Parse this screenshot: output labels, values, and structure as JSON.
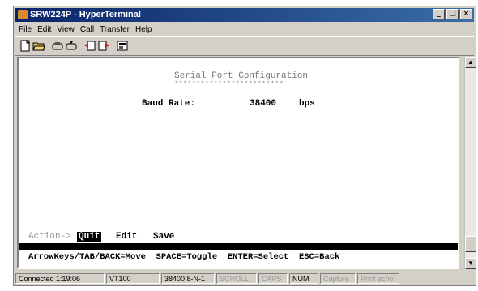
{
  "window": {
    "title": "SRW224P - HyperTerminal",
    "controls": {
      "minimize": "_",
      "maximize": "□",
      "close": "×"
    }
  },
  "menu": [
    "File",
    "Edit",
    "View",
    "Call",
    "Transfer",
    "Help"
  ],
  "toolbar_icons": [
    "new-icon",
    "open-icon",
    "connect-icon",
    "disconnect-icon",
    "send-icon",
    "receive-icon",
    "properties-icon"
  ],
  "terminal": {
    "heading": "Serial Port Configuration",
    "heading_underline": "*************************",
    "field_label": "Baud Rate:",
    "field_value": "38400",
    "field_unit": "bps",
    "action_label": "Action->",
    "actions": [
      "Quit",
      "Edit",
      "Save"
    ],
    "help_line": "ArrowKeys/TAB/BACK=Move  SPACE=Toggle  ENTER=Select  ESC=Back"
  },
  "status": {
    "connected": "Connected 1:19:06",
    "emulation": "VT100",
    "settings": "38400 8-N-1",
    "scroll": "SCROLL",
    "caps": "CAPS",
    "num": "NUM",
    "capture": "Capture",
    "print_echo": "Print echo"
  }
}
